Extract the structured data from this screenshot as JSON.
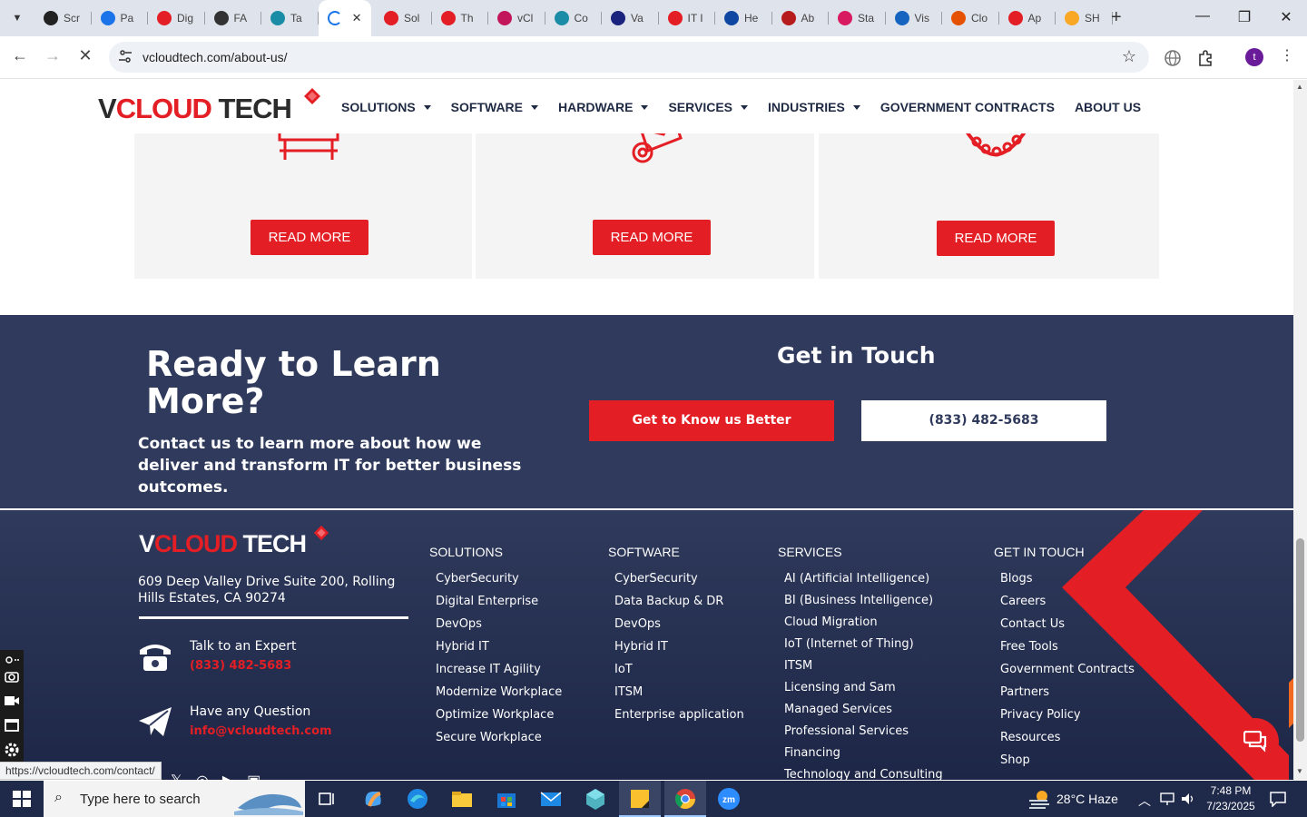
{
  "browser": {
    "tabs": [
      {
        "label": "Scr",
        "color": "#222"
      },
      {
        "label": "Pa",
        "color": "#1a73e8"
      },
      {
        "label": "Dig",
        "color": "#e31e24"
      },
      {
        "label": "FA",
        "color": "#333"
      },
      {
        "label": "Ta",
        "color": "#1b8ca6"
      },
      {
        "label": "",
        "color": "#1a73e8"
      },
      {
        "label": "Sol",
        "color": "#e31e24"
      },
      {
        "label": "Th",
        "color": "#e31e24"
      },
      {
        "label": "vCl",
        "color": "#c2185b"
      },
      {
        "label": "Co",
        "color": "#1b8ca6"
      },
      {
        "label": "Va",
        "color": "#1a237e"
      },
      {
        "label": "IT I",
        "color": "#e31e24"
      },
      {
        "label": "He",
        "color": "#0d47a1"
      },
      {
        "label": "Ab",
        "color": "#b71c1c"
      },
      {
        "label": "Sta",
        "color": "#d81b60"
      },
      {
        "label": "Vis",
        "color": "#1565c0"
      },
      {
        "label": "Clo",
        "color": "#e65100"
      },
      {
        "label": "Ap",
        "color": "#e31e24"
      },
      {
        "label": "SH",
        "color": "#f9a825"
      }
    ],
    "url": "vcloudtech.com/about-us/",
    "profile_initial": "t",
    "status_url": "https://vcloudtech.com/contact/"
  },
  "site": {
    "logo": {
      "v": "V",
      "cloud": "CLOUD",
      "tech": " TECH"
    },
    "nav": [
      {
        "label": "SOLUTIONS",
        "dropdown": true
      },
      {
        "label": "SOFTWARE",
        "dropdown": true
      },
      {
        "label": "HARDWARE",
        "dropdown": true
      },
      {
        "label": "SERVICES",
        "dropdown": true
      },
      {
        "label": "INDUSTRIES",
        "dropdown": true
      },
      {
        "label": "GOVERNMENT CONTRACTS",
        "dropdown": false
      },
      {
        "label": "ABOUT US",
        "dropdown": false
      }
    ],
    "cards": [
      {
        "button": "READ MORE",
        "icon": "desk-icon"
      },
      {
        "button": "READ MORE",
        "icon": "email-icon"
      },
      {
        "button": "READ MORE",
        "icon": "handshake-icon"
      }
    ],
    "cta": {
      "title": "Ready to Learn More?",
      "subtitle": "Contact us to learn more about how we deliver and transform IT for better business outcomes.",
      "get_in_touch": "Get in Touch",
      "know_button": "Get to Know us Better",
      "phone_button": "(833) 482-5683"
    },
    "footer": {
      "address": "609 Deep Valley Drive Suite 200, Rolling Hills Estates, CA 90274",
      "expert_label": "Talk to an Expert",
      "expert_phone": "(833) 482-5683",
      "question_label": "Have any Question",
      "question_email": "info@vcloudtech.com",
      "columns": {
        "solutions": {
          "title": "SOLUTIONS",
          "items": [
            "CyberSecurity",
            "Digital Enterprise",
            "DevOps",
            "Hybrid IT",
            "Increase IT Agility",
            "Modernize Workplace",
            "Optimize Workplace",
            "Secure Workplace"
          ]
        },
        "software": {
          "title": "SOFTWARE",
          "items": [
            "CyberSecurity",
            "Data Backup & DR",
            "DevOps",
            "Hybrid IT",
            "IoT",
            "ITSM",
            "Enterprise application"
          ]
        },
        "services": {
          "title": "SERVICES",
          "items": [
            "AI (Artificial Intelligence)",
            "BI (Business Intelligence)",
            "Cloud Migration",
            "IoT (Internet of Thing)",
            "ITSM",
            "Licensing and Sam",
            "Managed Services",
            "Professional Services",
            "Financing",
            "Technology and Consulting"
          ]
        },
        "get_in_touch": {
          "title": "GET IN TOUCH",
          "items": [
            "Blogs",
            "Careers",
            "Contact Us",
            "Free Tools",
            "Government Contracts",
            "Partners",
            "Privacy Policy",
            "Resources",
            "Shop"
          ]
        }
      }
    }
  },
  "taskbar": {
    "search_placeholder": "Type here to search",
    "weather": "28°C  Haze",
    "time": "7:48 PM",
    "date": "7/23/2025"
  },
  "colors": {
    "brand_red": "#e31e24",
    "navy": "#2f3a5c"
  }
}
